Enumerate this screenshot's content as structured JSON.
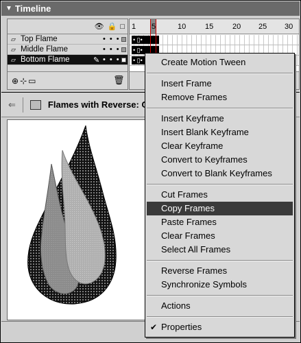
{
  "timeline": {
    "title": "Timeline",
    "header_icons": [
      "eye-icon",
      "lock-icon",
      "outline-icon"
    ],
    "layers": [
      {
        "name": "Top Flame",
        "selected": false
      },
      {
        "name": "Middle Flame",
        "selected": false
      },
      {
        "name": "Bottom Flame",
        "selected": true
      }
    ],
    "ruler": [
      "1",
      "5",
      "10",
      "15",
      "20",
      "25",
      "30"
    ],
    "current_frame": "5"
  },
  "editbar": {
    "scene_name": "Flames with Reverse: Co"
  },
  "context_menu": {
    "groups": [
      [
        {
          "label": "Create Motion Tween"
        }
      ],
      [
        {
          "label": "Insert Frame"
        },
        {
          "label": "Remove Frames"
        }
      ],
      [
        {
          "label": "Insert Keyframe"
        },
        {
          "label": "Insert Blank Keyframe"
        },
        {
          "label": "Clear Keyframe"
        },
        {
          "label": "Convert to Keyframes"
        },
        {
          "label": "Convert to Blank Keyframes"
        }
      ],
      [
        {
          "label": "Cut Frames"
        },
        {
          "label": "Copy Frames",
          "highlighted": true
        },
        {
          "label": "Paste Frames"
        },
        {
          "label": "Clear Frames"
        },
        {
          "label": "Select All Frames"
        }
      ],
      [
        {
          "label": "Reverse Frames"
        },
        {
          "label": "Synchronize Symbols"
        }
      ],
      [
        {
          "label": "Actions"
        }
      ],
      [
        {
          "label": "Properties",
          "checked": true
        }
      ]
    ]
  },
  "colors": {
    "titlebar": "#6a6a6a",
    "menu_highlight": "#3a3a3a",
    "selected_layer": "#111111"
  }
}
